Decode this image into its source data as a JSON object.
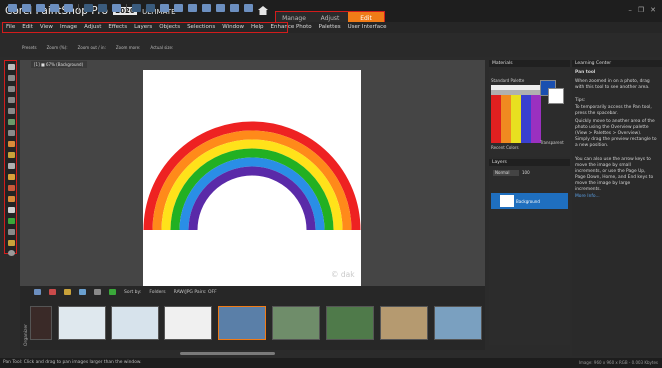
{
  "app": {
    "name": "Corel PaintShop Pro",
    "version_badge": "2020",
    "edition": "ULTIMATE",
    "workspace_tabs": [
      {
        "label": "Manage",
        "active": false
      },
      {
        "label": "Adjust",
        "active": false
      },
      {
        "label": "Edit",
        "active": true
      }
    ],
    "accent_color": "#f07b17",
    "highlight_color": "#d21c1c"
  },
  "menubar": {
    "items": [
      "File",
      "Edit",
      "View",
      "Image",
      "Adjust",
      "Effects",
      "Layers",
      "Objects",
      "Selections",
      "Window",
      "Help",
      "Enhance Photo",
      "Palettes",
      "User Interface"
    ]
  },
  "tool_options": {
    "labels": [
      "Presets",
      "Zoom (%):",
      "Zoom out / in:",
      "Zoom more:",
      "Actual size:"
    ]
  },
  "document": {
    "tab_label": "[1] ■ 67% (Background)",
    "watermark": "© dak"
  },
  "organizer": {
    "side_label": "Organizer",
    "sort_label": "Sort by:",
    "sort_value": "Folders",
    "raw_label": "RAW/JPG Pairs: OFF"
  },
  "materials": {
    "title": "Materials",
    "dropdown": "Standard Palette",
    "recent_label": "Recent Colors",
    "transparent_label": "Transparent"
  },
  "layers": {
    "title": "Layers",
    "blend_mode": "Normal",
    "opacity": "100",
    "layer_name": "Background"
  },
  "learning_center": {
    "title": "Learning Center",
    "tool_name": "Pan tool",
    "intro": "When zoomed in on a photo, drag with this tool to see another area.",
    "tips_heading": "Tips:",
    "tips": [
      "To temporarily access the Pan tool, press the spacebar.",
      "Quickly move to another area of the photo using the Overview palette (View > Palettes > Overview). Simply drag the preview rectangle to a new position.",
      "You can also use the arrow keys to move the image by small increments, or use the Page Up, Page Down, Home, and End keys to move the image by large increments."
    ],
    "more_link": "More Info..."
  },
  "status": {
    "left": "Pan Tool: Click and drag to pan images larger than the window.",
    "right": "Image: 960 x 960 x RGB - 0.003 Kbytes"
  }
}
